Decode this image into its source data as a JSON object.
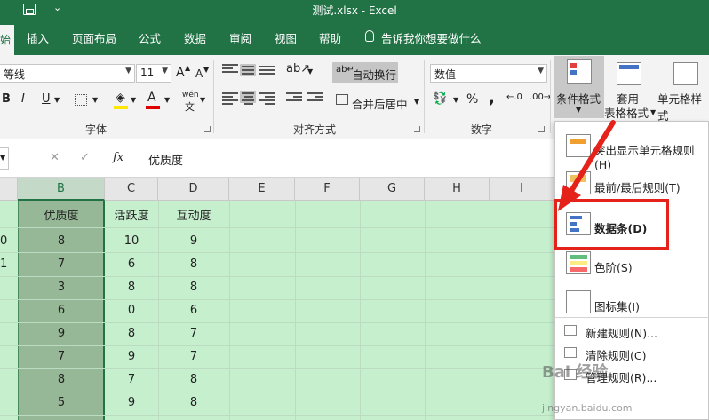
{
  "window": {
    "title": "测试.xlsx  -  Excel",
    "qat_more": "⌄"
  },
  "tabs": {
    "home": "始",
    "items": [
      "插入",
      "页面布局",
      "公式",
      "数据",
      "审阅",
      "视图",
      "帮助"
    ],
    "tell_me": "告诉我你想要做什么"
  },
  "ribbon": {
    "font_name": "等线",
    "font_size": "11",
    "grow_font": "A",
    "shrink_font": "A",
    "bold": "B",
    "italic": "I",
    "underline": "U",
    "font_color": "A",
    "phonetic": "wén",
    "wrap_text": "自动换行",
    "merge_center": "合并后居中",
    "number_format": "数值",
    "percent": "%",
    "comma": ",",
    "group_font": "字体",
    "group_alignment": "对齐方式",
    "group_number": "数字",
    "conditional_format_line1": "条件格式",
    "table_format_line1": "套用",
    "table_format_line2": "表格格式",
    "cell_styles": "单元格样式",
    "accent_color": "#217346"
  },
  "formula_bar": {
    "cancel": "✕",
    "enter": "✓",
    "fx": "fx",
    "content": "优质度"
  },
  "grid": {
    "columns": [
      "B",
      "C",
      "D",
      "E",
      "F",
      "G",
      "H",
      "I"
    ],
    "selected_column": "B",
    "header_row": [
      "优质度",
      "活跃度",
      "互动度"
    ],
    "rows": [
      [
        "8",
        "10",
        "9"
      ],
      [
        "7",
        "6",
        "8"
      ],
      [
        "3",
        "8",
        "8"
      ],
      [
        "6",
        "0",
        "6"
      ],
      [
        "9",
        "8",
        "7"
      ],
      [
        "7",
        "9",
        "7"
      ],
      [
        "8",
        "7",
        "8"
      ],
      [
        "5",
        "9",
        "8"
      ]
    ],
    "left_partial": [
      "0",
      "1"
    ],
    "fill_color": "#c6efce",
    "selected_fill": "#96b896"
  },
  "menu": {
    "items": [
      {
        "label": "突出显示单元格规则(H)"
      },
      {
        "label": "最前/最后规则(T)"
      },
      {
        "label": "数据条(D)"
      },
      {
        "label": "色阶(S)"
      },
      {
        "label": "图标集(I)"
      }
    ],
    "small_items": [
      {
        "label": "新建规则(N)..."
      },
      {
        "label": "清除规则(C)"
      },
      {
        "label": "管理规则(R)..."
      }
    ],
    "highlight_color": "#e5221a"
  },
  "watermark": "Bai 经验",
  "watermark_url": "jingyan.baidu.com"
}
